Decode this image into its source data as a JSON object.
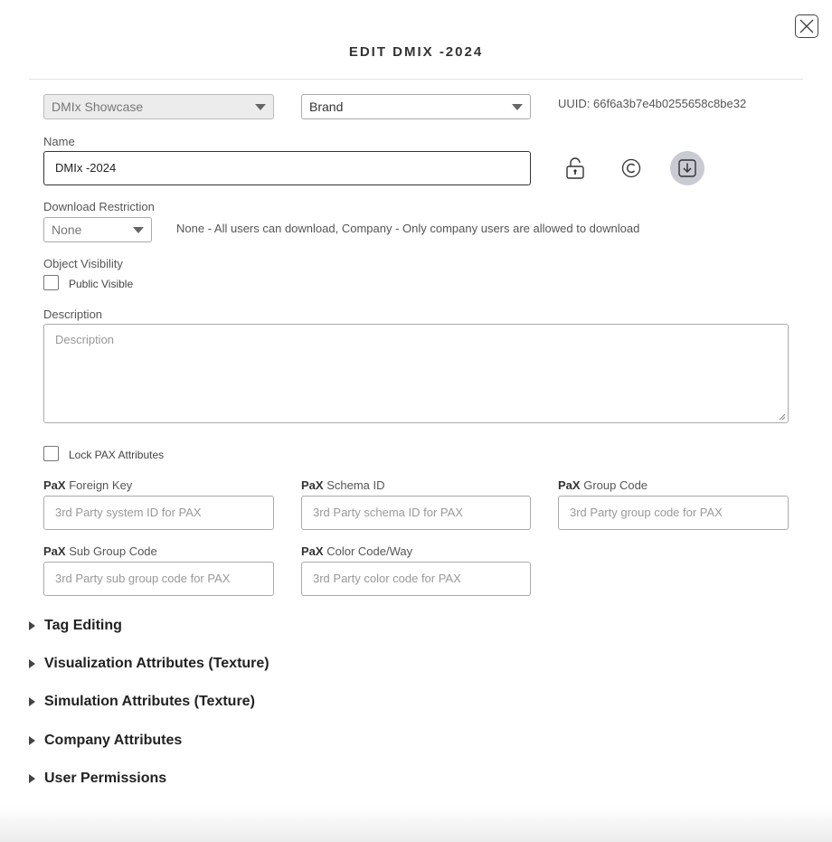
{
  "dialog": {
    "title": "EDIT DMIX -2024",
    "close_icon": "close-icon"
  },
  "selectors": {
    "showcase": "DMIx Showcase",
    "category": "Brand",
    "uuid": "UUID: 66f6a3b7e4b0255658c8be32"
  },
  "name": {
    "label": "Name",
    "value": "DMIx -2024",
    "icons": [
      "lock-icon",
      "copyright-icon",
      "download-icon"
    ]
  },
  "download_restriction": {
    "label": "Download Restriction",
    "value": "None",
    "hint": "None - All users can download, Company - Only company users are allowed to download"
  },
  "visibility": {
    "label": "Object Visibility",
    "checkbox_label": "Public Visible"
  },
  "description": {
    "label": "Description",
    "placeholder": "Description"
  },
  "pax": {
    "lock_label": "Lock PAX Attributes",
    "prefix": "PaX",
    "fields": [
      {
        "label": "Foreign Key",
        "placeholder": "3rd Party system ID for PAX"
      },
      {
        "label": "Schema ID",
        "placeholder": "3rd Party schema ID for PAX"
      },
      {
        "label": "Group Code",
        "placeholder": "3rd Party group code for PAX"
      },
      {
        "label": "Sub Group Code",
        "placeholder": "3rd Party sub group code for PAX"
      },
      {
        "label": "Color Code/Way",
        "placeholder": "3rd Party color code for PAX"
      }
    ]
  },
  "sections": [
    "Tag Editing",
    "Visualization Attributes (Texture)",
    "Simulation Attributes (Texture)",
    "Company Attributes",
    "User Permissions"
  ]
}
